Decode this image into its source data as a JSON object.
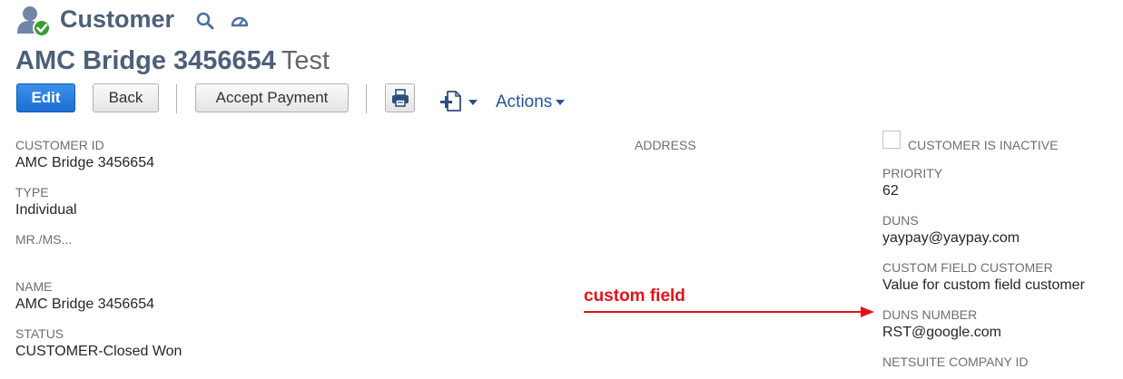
{
  "header": {
    "record_type": "Customer",
    "title": "AMC Bridge 3456654",
    "subtitle": "Test"
  },
  "toolbar": {
    "edit_label": "Edit",
    "back_label": "Back",
    "accept_payment_label": "Accept Payment",
    "actions_label": "Actions"
  },
  "fields": {
    "customer_id": {
      "label": "CUSTOMER ID",
      "value": "AMC Bridge 3456654"
    },
    "type": {
      "label": "TYPE",
      "value": "Individual"
    },
    "salutation": {
      "label": "MR./MS...",
      "value": ""
    },
    "name": {
      "label": "NAME",
      "value": "AMC Bridge 3456654"
    },
    "status": {
      "label": "STATUS",
      "value": "CUSTOMER-Closed Won"
    },
    "address": {
      "label": "ADDRESS",
      "value": ""
    },
    "customer_inactive": {
      "label": "CUSTOMER IS INACTIVE",
      "checked": false
    },
    "priority": {
      "label": "PRIORITY",
      "value": "62"
    },
    "duns": {
      "label": "DUNS",
      "value": "yaypay@yaypay.com"
    },
    "custom_field_customer": {
      "label": "CUSTOM FIELD CUSTOMER",
      "value": "Value for custom field customer"
    },
    "duns_number": {
      "label": "DUNS NUMBER",
      "value": "RST@google.com"
    },
    "netsuite_company_id": {
      "label": "NETSUITE COMPANY ID",
      "value": ""
    }
  },
  "annotation": {
    "text": "custom field",
    "color": "#e0131a"
  },
  "icons": {
    "record": "customer-person-check-icon",
    "search": "search-icon",
    "dashboard": "dashboard-gauge-icon",
    "print": "print-icon",
    "new_document": "new-document-icon"
  },
  "colors": {
    "brand_title": "#4d5f79",
    "primary_button": "#1c6fd4",
    "link": "#255599"
  }
}
